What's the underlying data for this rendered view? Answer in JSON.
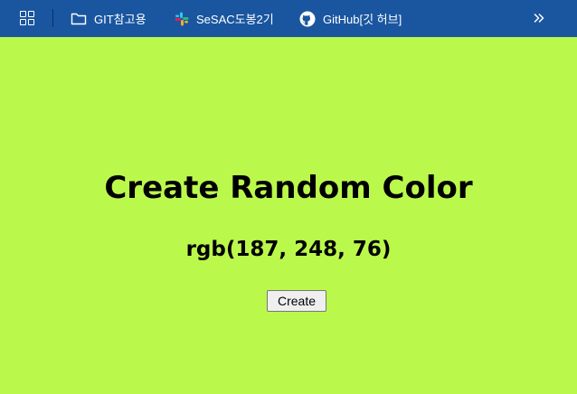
{
  "bookmarks_bar": {
    "apps_icon": "apps-grid-icon",
    "items": [
      {
        "label": "GIT참고용",
        "icon": "folder-icon"
      },
      {
        "label": "SeSAC도봉2기",
        "icon": "slack-icon"
      },
      {
        "label": "GitHub[깃 허브]",
        "icon": "github-icon"
      }
    ],
    "overflow_icon": "double-chevron-right-icon",
    "background": "#1a56a0"
  },
  "main": {
    "title": "Create Random Color",
    "rgb_text": "rgb(187, 248, 76)",
    "background_color": "#bbf84c",
    "create_button_label": "Create"
  }
}
